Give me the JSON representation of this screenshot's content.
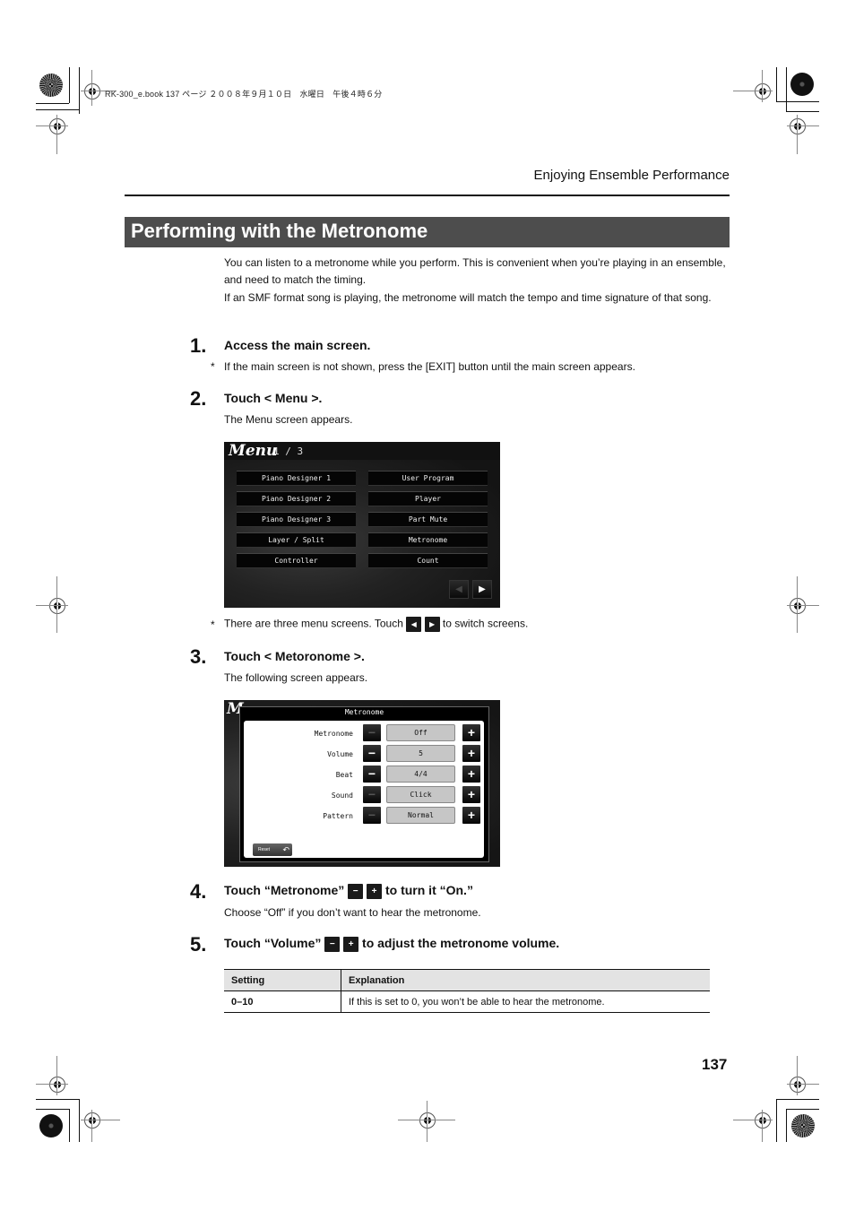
{
  "print_header": "RK-300_e.book  137 ページ  ２００８年９月１０日　水曜日　午後４時６分",
  "running_head": "Enjoying Ensemble Performance",
  "section_title": "Performing with the Metronome",
  "intro": [
    "You can listen to a metronome while you perform. This is convenient when you’re playing in an ensemble, and need to match the timing.",
    "If an SMF format song is playing, the metronome will match the tempo and time signature of that song."
  ],
  "steps": [
    {
      "num": "1.",
      "title": "Access the main screen.",
      "note": "If the main screen is not shown, press the [EXIT] button until the main screen appears."
    },
    {
      "num": "2.",
      "title": "Touch < Menu >.",
      "sub": "The Menu screen appears.",
      "note_pre": "There are three menu screens. Touch",
      "note_post": "to switch screens."
    },
    {
      "num": "3.",
      "title": "Touch < Metoronome >.",
      "sub": "The following screen appears."
    },
    {
      "num": "4.",
      "title_pre": "Touch “Metronome”",
      "title_post": "to turn it “On.”",
      "sub": "Choose “Off” if you don’t want to hear the metronome."
    },
    {
      "num": "5.",
      "title_pre": "Touch “Volume”",
      "title_post": "to adjust the metronome volume."
    }
  ],
  "star": "*",
  "icons": {
    "minus": "−",
    "plus": "+",
    "left": "◀",
    "right": "▶"
  },
  "menu_screen": {
    "title": "Menu",
    "page": "1 / 3",
    "left_buttons": [
      "Piano Designer 1",
      "Piano Designer 2",
      "Piano Designer 3",
      "Layer / Split",
      "Controller"
    ],
    "right_buttons": [
      "User Program",
      "Player",
      "Part Mute",
      "Metronome",
      "Count"
    ]
  },
  "metronome_screen": {
    "bg_letter": "M",
    "title": "Metronome",
    "params": [
      {
        "label": "Metronome",
        "value": "Off"
      },
      {
        "label": "Volume",
        "value": "5"
      },
      {
        "label": "Beat",
        "value": "4/4"
      },
      {
        "label": "Sound",
        "value": "Click"
      },
      {
        "label": "Pattern",
        "value": "Normal"
      }
    ],
    "reset_label": "Reset"
  },
  "table": {
    "headers": [
      "Setting",
      "Explanation"
    ],
    "rows": [
      [
        "0–10",
        "If this is set to 0, you won’t be able to hear the metronome."
      ]
    ]
  },
  "page_number": "137"
}
